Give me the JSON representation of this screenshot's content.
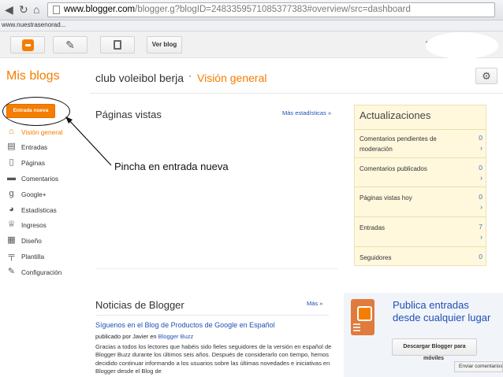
{
  "browser": {
    "url_host": "www.blogger.com",
    "url_rest": "/blogger.g?blogID=2483359571085377383#overview/src=dashboard",
    "bookmark": "www.nuestrasenorad..."
  },
  "toolbar": {
    "view_blog_label": "Ver blog"
  },
  "sidebar": {
    "title": "Mis blogs",
    "new_post_label": "Entrada nueva",
    "items": [
      {
        "label": "Visión general",
        "icon": "home-icon",
        "glyph": "⌂"
      },
      {
        "label": "Entradas",
        "icon": "posts-icon",
        "glyph": "▤"
      },
      {
        "label": "Páginas",
        "icon": "pages-icon",
        "glyph": "▯"
      },
      {
        "label": "Comentarios",
        "icon": "comments-icon",
        "glyph": "▬"
      },
      {
        "label": "Google+",
        "icon": "google-plus-icon",
        "glyph": "g"
      },
      {
        "label": "Estadísticas",
        "icon": "stats-pie-icon",
        "glyph": "◕"
      },
      {
        "label": "Ingresos",
        "icon": "trophy-icon",
        "glyph": "♕"
      },
      {
        "label": "Diseño",
        "icon": "layout-icon",
        "glyph": "▦"
      },
      {
        "label": "Plantilla",
        "icon": "template-icon",
        "glyph": "╤"
      },
      {
        "label": "Configuración",
        "icon": "wrench-icon",
        "glyph": "✎"
      }
    ]
  },
  "header": {
    "blog_title": "club voleibol berja",
    "separator": "·",
    "section_title": "Visión general"
  },
  "pageviews": {
    "title": "Páginas vistas",
    "more_link": "Más estadísticas »"
  },
  "annotation": {
    "text": "Pincha en entrada nueva"
  },
  "updates": {
    "title": "Actualizaciones",
    "rows": [
      {
        "label": "Comentarios pendientes de moderación",
        "value": "0"
      },
      {
        "label": "Comentarios publicados",
        "value": "0"
      },
      {
        "label": "Páginas vistas hoy",
        "value": "0"
      },
      {
        "label": "Entradas",
        "value": "7"
      },
      {
        "label": "Seguidores",
        "value": "0"
      }
    ],
    "arrow": "›"
  },
  "news": {
    "title": "Noticias de Blogger",
    "more_link": "Más »",
    "headline": "Síguenos en el Blog de Productos de Google en Español",
    "byline_prefix": "publicado por Javier en",
    "byline_link": "Blogger Buzz",
    "body": "Gracias a todos los lectores que habéis sido fieles seguidores de la versión en español de Blogger Buzz durante los últimos seis años. Después de considerarlo con tiempo, hemos decidido continuar informando a los usuarios sobre las últimas novedades e iniciativas en Blogger desde el Blog de"
  },
  "promo": {
    "text": "Publica entradas desde cualquier lugar",
    "download_label": "Descargar Blogger para",
    "download_suffix": "móviles"
  },
  "feedback": {
    "label": "Enviar comentarios"
  },
  "colors": {
    "accent": "#f57d00",
    "link": "#1f4fb5",
    "updates_bg": "#fff8dd"
  }
}
